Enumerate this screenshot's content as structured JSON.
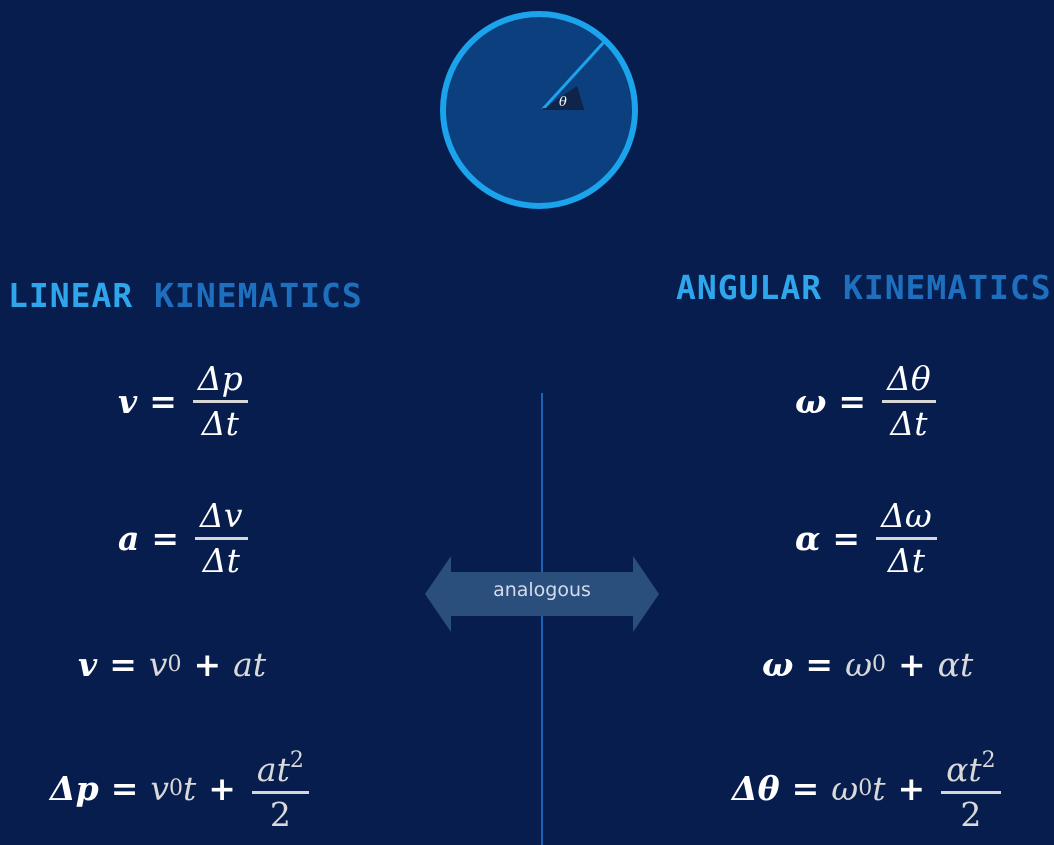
{
  "diagram": {
    "angle_label": "θ"
  },
  "headings": {
    "linear": {
      "word1": "LINEAR",
      "word2": "KINEMATICS"
    },
    "angular": {
      "word1": "ANGULAR",
      "word2": "KINEMATICS"
    }
  },
  "arrow": {
    "label": "analogous"
  },
  "linear_equations": [
    {
      "lhs": "v",
      "num": "Δp",
      "den": "Δt"
    },
    {
      "lhs": "a",
      "num": "Δv",
      "den": "Δt"
    },
    {
      "lhs": "v",
      "r1": "v",
      "r1_sub": "0",
      "plus": "+",
      "r2": "at"
    },
    {
      "lhs": "Δp",
      "r1": "v",
      "r1_sub": "0",
      "r1_tail": "t",
      "plus": "+",
      "num": "at",
      "num_sup": "2",
      "den": "2"
    }
  ],
  "angular_equations": [
    {
      "lhs": "ω",
      "num": "Δθ",
      "den": "Δt"
    },
    {
      "lhs": "α",
      "num": "Δω",
      "den": "Δt"
    },
    {
      "lhs": "ω",
      "r1": "ω",
      "r1_sub": "0",
      "plus": "+",
      "r2": "αt"
    },
    {
      "lhs": "Δθ",
      "r1": "ω",
      "r1_sub": "0",
      "r1_tail": "t",
      "plus": "+",
      "num": "αt",
      "num_sup": "2",
      "den": "2"
    }
  ],
  "operators": {
    "equals": "="
  },
  "colors": {
    "background": "#061d4d",
    "circle_fill": "#0b3f7e",
    "circle_stroke": "#1ba3ec",
    "heading_accent": "#2fa6ec",
    "heading_secondary": "#1f6fbf",
    "divider": "#1b63b8",
    "arrow_fill": "#2b4f7c"
  }
}
